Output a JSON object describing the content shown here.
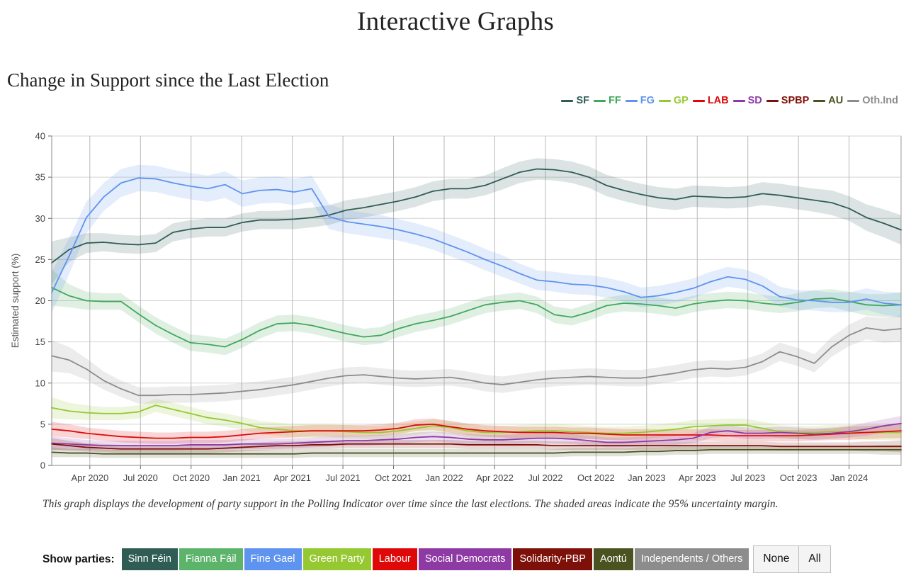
{
  "header": {
    "page_title": "Interactive Graphs",
    "section_title": "Change in Support since the Last Election"
  },
  "caption": "This graph displays the development of party support in the Polling Indicator over time since the last elections. The shaded areas indicate the 95% uncertainty margin.",
  "controls": {
    "show_parties_label": "Show parties:",
    "parties": [
      {
        "label": "Sinn Féin",
        "color": "#2f5d56"
      },
      {
        "label": "Fianna Fáil",
        "color": "#5cb36a"
      },
      {
        "label": "Fine Gael",
        "color": "#5e93ef"
      },
      {
        "label": "Green Party",
        "color": "#95c831"
      },
      {
        "label": "Labour",
        "color": "#df0808"
      },
      {
        "label": "Social Democrats",
        "color": "#8e3aa4"
      },
      {
        "label": "Solidarity-PBP",
        "color": "#7d1008"
      },
      {
        "label": "Aontú",
        "color": "#4a5320"
      },
      {
        "label": "Independents / Others",
        "color": "#8c8c8c"
      }
    ],
    "none_label": "None",
    "all_label": "All"
  },
  "chart_data": {
    "type": "line",
    "title": "Change in Support since the Last Election",
    "xlabel": "",
    "ylabel": "Estimated support (%)",
    "ylim": [
      0,
      40
    ],
    "yticks": [
      0,
      5,
      10,
      15,
      20,
      25,
      30,
      35,
      40
    ],
    "grid": true,
    "legend_position": "top-right",
    "uncertainty": "95% uncertainty margin (shaded bands)",
    "xticks": [
      "Apr 2020",
      "Jul 2020",
      "Oct 2020",
      "Jan 2021",
      "Apr 2021",
      "Jul 2021",
      "Oct 2021",
      "Jan 2022",
      "Apr 2022",
      "Jul 2022",
      "Oct 2022",
      "Jan 2023",
      "Apr 2023",
      "Jul 2023",
      "Oct 2023",
      "Jan 2024"
    ],
    "x_start": "Feb 2020",
    "x_end": "Mar 2024",
    "x": [
      0,
      1,
      2,
      3,
      4,
      5,
      6,
      7,
      8,
      9,
      10,
      11,
      12,
      13,
      14,
      15,
      16,
      17,
      18,
      19,
      20,
      21,
      22,
      23,
      24,
      25,
      26,
      27,
      28,
      29,
      30,
      31,
      32,
      33,
      34,
      35,
      36,
      37,
      38,
      39,
      40,
      41,
      42,
      43,
      44,
      45,
      46,
      47,
      48,
      49
    ],
    "series": [
      {
        "name": "SF",
        "legend": "SF",
        "full_name": "Sinn Féin",
        "color": "#2f5d56",
        "values": [
          24.6,
          26.2,
          27.0,
          27.1,
          26.9,
          26.8,
          27.0,
          28.3,
          28.7,
          28.9,
          28.9,
          29.5,
          29.8,
          29.8,
          29.9,
          30.1,
          30.4,
          31.0,
          31.3,
          31.7,
          32.1,
          32.6,
          33.3,
          33.6,
          33.6,
          34.0,
          34.8,
          35.6,
          36.0,
          35.9,
          35.6,
          35.0,
          34.0,
          33.4,
          32.9,
          32.5,
          32.3,
          32.7,
          32.6,
          32.5,
          32.6,
          33.0,
          32.8,
          32.5,
          32.2,
          31.9,
          31.2,
          30.1,
          29.4,
          28.6
        ],
        "ci": [
          2.6,
          1.5,
          1.2,
          1.1,
          1.1,
          1.1,
          1.1,
          1.1,
          1.1,
          1.1,
          1.1,
          1.1,
          1.1,
          1.1,
          1.2,
          1.2,
          1.2,
          1.2,
          1.2,
          1.2,
          1.2,
          1.2,
          1.2,
          1.2,
          1.2,
          1.2,
          1.3,
          1.3,
          1.3,
          1.3,
          1.3,
          1.3,
          1.3,
          1.3,
          1.3,
          1.3,
          1.3,
          1.3,
          1.3,
          1.3,
          1.3,
          1.4,
          1.4,
          1.4,
          1.4,
          1.5,
          1.5,
          1.6,
          1.7,
          1.8
        ]
      },
      {
        "name": "FF",
        "legend": "FF",
        "full_name": "Fianna Fáil",
        "color": "#3fa85a",
        "values": [
          21.6,
          20.6,
          20.0,
          19.9,
          19.9,
          18.4,
          17.0,
          15.9,
          14.9,
          14.7,
          14.4,
          15.3,
          16.4,
          17.2,
          17.3,
          17.0,
          16.5,
          16.0,
          15.6,
          15.8,
          16.6,
          17.2,
          17.6,
          18.1,
          18.8,
          19.5,
          19.8,
          20.0,
          19.5,
          18.3,
          18.0,
          18.6,
          19.4,
          19.7,
          19.6,
          19.4,
          19.1,
          19.6,
          19.9,
          20.1,
          20.0,
          19.7,
          19.5,
          19.8,
          20.2,
          20.3,
          19.9,
          19.5,
          19.4,
          19.5
        ],
        "ci": [
          2.2,
          1.4,
          1.1,
          1.0,
          1.0,
          1.0,
          1.0,
          1.0,
          1.0,
          1.0,
          1.0,
          1.0,
          1.0,
          1.0,
          1.0,
          1.0,
          1.0,
          1.0,
          1.0,
          1.0,
          1.0,
          1.0,
          1.0,
          1.0,
          1.0,
          1.0,
          1.0,
          1.0,
          1.0,
          1.0,
          1.0,
          1.0,
          1.0,
          1.0,
          1.0,
          1.0,
          1.0,
          1.0,
          1.0,
          1.0,
          1.0,
          1.0,
          1.0,
          1.1,
          1.1,
          1.1,
          1.2,
          1.3,
          1.4,
          1.5
        ]
      },
      {
        "name": "FG",
        "legend": "FG",
        "full_name": "Fine Gael",
        "color": "#5e93ef",
        "values": [
          21.0,
          25.4,
          30.1,
          32.6,
          34.3,
          34.9,
          34.8,
          34.3,
          33.9,
          33.6,
          34.1,
          33.0,
          33.4,
          33.5,
          33.2,
          33.6,
          30.2,
          29.6,
          29.3,
          29.0,
          28.6,
          28.1,
          27.5,
          26.7,
          25.9,
          25.0,
          24.2,
          23.3,
          22.5,
          22.3,
          22.0,
          21.9,
          21.6,
          21.1,
          20.4,
          20.6,
          21.0,
          21.5,
          22.3,
          22.9,
          22.6,
          21.8,
          20.5,
          20.1,
          20.0,
          19.8,
          19.8,
          20.2,
          19.7,
          19.5
        ],
        "ci": [
          2.5,
          2.2,
          1.9,
          1.7,
          1.7,
          1.6,
          1.6,
          1.6,
          1.6,
          1.6,
          1.6,
          1.6,
          1.6,
          1.6,
          1.6,
          1.6,
          1.5,
          1.4,
          1.4,
          1.4,
          1.3,
          1.3,
          1.3,
          1.3,
          1.3,
          1.3,
          1.3,
          1.2,
          1.2,
          1.2,
          1.2,
          1.2,
          1.2,
          1.2,
          1.2,
          1.2,
          1.2,
          1.2,
          1.2,
          1.2,
          1.2,
          1.2,
          1.2,
          1.2,
          1.2,
          1.2,
          1.2,
          1.3,
          1.4,
          1.5
        ]
      },
      {
        "name": "GP",
        "legend": "GP",
        "full_name": "Green Party",
        "color": "#95c831",
        "values": [
          7.0,
          6.6,
          6.4,
          6.3,
          6.3,
          6.5,
          7.3,
          6.8,
          6.3,
          5.8,
          5.5,
          5.1,
          4.6,
          4.4,
          4.2,
          4.2,
          4.2,
          4.1,
          4.0,
          4.0,
          4.2,
          4.5,
          4.8,
          4.6,
          4.2,
          4.0,
          4.0,
          4.1,
          4.2,
          4.2,
          4.1,
          4.0,
          3.9,
          3.9,
          4.0,
          4.2,
          4.4,
          4.7,
          4.8,
          4.9,
          4.9,
          4.5,
          4.1,
          4.0,
          4.0,
          4.1,
          4.1,
          4.0,
          4.0,
          4.0
        ],
        "ci": [
          1.3,
          1.0,
          0.9,
          0.8,
          0.8,
          0.8,
          0.8,
          0.8,
          0.8,
          0.8,
          0.8,
          0.8,
          0.8,
          0.8,
          0.8,
          0.8,
          0.8,
          0.8,
          0.8,
          0.8,
          0.8,
          0.8,
          0.8,
          0.8,
          0.8,
          0.8,
          0.8,
          0.8,
          0.8,
          0.8,
          0.8,
          0.8,
          0.8,
          0.8,
          0.8,
          0.8,
          0.8,
          0.8,
          0.8,
          0.8,
          0.8,
          0.8,
          0.8,
          0.8,
          0.8,
          0.8,
          0.8,
          0.9,
          0.9,
          1.0
        ]
      },
      {
        "name": "LAB",
        "legend": "LAB",
        "full_name": "Labour",
        "color": "#df0808",
        "values": [
          4.4,
          4.2,
          3.9,
          3.7,
          3.5,
          3.4,
          3.3,
          3.3,
          3.4,
          3.4,
          3.5,
          3.7,
          3.9,
          4.0,
          4.1,
          4.2,
          4.2,
          4.2,
          4.2,
          4.3,
          4.5,
          4.9,
          5.0,
          4.7,
          4.4,
          4.2,
          4.1,
          4.0,
          4.0,
          4.0,
          3.9,
          3.9,
          3.8,
          3.7,
          3.7,
          3.7,
          3.7,
          3.7,
          3.7,
          3.6,
          3.6,
          3.6,
          3.6,
          3.6,
          3.7,
          3.8,
          3.9,
          4.0,
          4.1,
          4.2
        ],
        "ci": [
          0.9,
          0.8,
          0.7,
          0.7,
          0.7,
          0.7,
          0.7,
          0.7,
          0.7,
          0.7,
          0.7,
          0.7,
          0.7,
          0.7,
          0.7,
          0.7,
          0.7,
          0.7,
          0.7,
          0.7,
          0.7,
          0.7,
          0.7,
          0.7,
          0.7,
          0.7,
          0.7,
          0.7,
          0.7,
          0.7,
          0.7,
          0.7,
          0.7,
          0.7,
          0.7,
          0.7,
          0.7,
          0.7,
          0.7,
          0.7,
          0.7,
          0.7,
          0.7,
          0.7,
          0.7,
          0.7,
          0.8,
          0.8,
          0.8,
          0.9
        ]
      },
      {
        "name": "SD",
        "legend": "SD",
        "full_name": "Social Democrats",
        "color": "#8e3aa4",
        "values": [
          2.7,
          2.6,
          2.5,
          2.4,
          2.4,
          2.4,
          2.4,
          2.4,
          2.5,
          2.5,
          2.5,
          2.6,
          2.6,
          2.6,
          2.7,
          2.8,
          2.9,
          3.0,
          3.0,
          3.1,
          3.2,
          3.4,
          3.5,
          3.4,
          3.2,
          3.1,
          3.1,
          3.2,
          3.3,
          3.3,
          3.2,
          3.0,
          2.8,
          2.8,
          2.9,
          3.0,
          3.1,
          3.3,
          4.0,
          4.2,
          3.9,
          3.9,
          4.0,
          3.9,
          3.8,
          3.9,
          4.1,
          4.4,
          4.8,
          5.1
        ],
        "ci": [
          0.8,
          0.7,
          0.6,
          0.6,
          0.6,
          0.6,
          0.6,
          0.6,
          0.6,
          0.6,
          0.6,
          0.6,
          0.6,
          0.6,
          0.6,
          0.6,
          0.6,
          0.6,
          0.6,
          0.6,
          0.6,
          0.6,
          0.6,
          0.6,
          0.6,
          0.6,
          0.6,
          0.6,
          0.6,
          0.6,
          0.6,
          0.6,
          0.6,
          0.6,
          0.6,
          0.6,
          0.6,
          0.6,
          0.7,
          0.7,
          0.7,
          0.7,
          0.7,
          0.7,
          0.7,
          0.7,
          0.7,
          0.8,
          0.8,
          0.9
        ]
      },
      {
        "name": "SPBP",
        "legend": "SPBP",
        "full_name": "Solidarity-PBP",
        "color": "#7d1008",
        "values": [
          2.6,
          2.4,
          2.2,
          2.1,
          2.0,
          2.0,
          2.0,
          2.0,
          2.0,
          2.0,
          2.1,
          2.2,
          2.3,
          2.4,
          2.4,
          2.5,
          2.5,
          2.6,
          2.6,
          2.6,
          2.6,
          2.6,
          2.6,
          2.6,
          2.5,
          2.5,
          2.5,
          2.5,
          2.5,
          2.4,
          2.4,
          2.4,
          2.4,
          2.4,
          2.4,
          2.4,
          2.4,
          2.4,
          2.4,
          2.4,
          2.4,
          2.4,
          2.3,
          2.3,
          2.3,
          2.3,
          2.3,
          2.3,
          2.3,
          2.3
        ],
        "ci": [
          0.7,
          0.6,
          0.5,
          0.5,
          0.5,
          0.5,
          0.5,
          0.5,
          0.5,
          0.5,
          0.5,
          0.5,
          0.5,
          0.5,
          0.5,
          0.5,
          0.5,
          0.5,
          0.5,
          0.5,
          0.5,
          0.5,
          0.5,
          0.5,
          0.5,
          0.5,
          0.5,
          0.5,
          0.5,
          0.5,
          0.5,
          0.5,
          0.5,
          0.5,
          0.5,
          0.5,
          0.5,
          0.5,
          0.5,
          0.5,
          0.5,
          0.5,
          0.5,
          0.5,
          0.5,
          0.5,
          0.5,
          0.6,
          0.6,
          0.7
        ]
      },
      {
        "name": "AU",
        "legend": "AU",
        "full_name": "Aontú",
        "color": "#4a5320",
        "values": [
          1.6,
          1.5,
          1.5,
          1.4,
          1.4,
          1.4,
          1.4,
          1.4,
          1.4,
          1.4,
          1.4,
          1.4,
          1.4,
          1.4,
          1.4,
          1.5,
          1.5,
          1.5,
          1.5,
          1.5,
          1.5,
          1.5,
          1.5,
          1.5,
          1.5,
          1.5,
          1.5,
          1.5,
          1.5,
          1.5,
          1.6,
          1.6,
          1.6,
          1.6,
          1.7,
          1.7,
          1.8,
          1.8,
          1.9,
          1.9,
          1.9,
          1.9,
          1.9,
          1.9,
          1.9,
          1.9,
          1.9,
          1.9,
          1.9,
          1.9
        ],
        "ci": [
          0.6,
          0.5,
          0.5,
          0.5,
          0.5,
          0.5,
          0.5,
          0.5,
          0.5,
          0.5,
          0.5,
          0.5,
          0.5,
          0.5,
          0.5,
          0.5,
          0.5,
          0.5,
          0.5,
          0.5,
          0.5,
          0.5,
          0.5,
          0.5,
          0.5,
          0.5,
          0.5,
          0.5,
          0.5,
          0.5,
          0.5,
          0.5,
          0.5,
          0.5,
          0.5,
          0.5,
          0.5,
          0.5,
          0.5,
          0.5,
          0.5,
          0.5,
          0.5,
          0.5,
          0.5,
          0.5,
          0.5,
          0.5,
          0.6,
          0.6
        ]
      },
      {
        "name": "Oth.Ind",
        "legend": "Oth.Ind",
        "full_name": "Independents / Others",
        "color": "#8c8c8c",
        "values": [
          13.3,
          12.8,
          11.7,
          10.3,
          9.3,
          8.5,
          8.5,
          8.6,
          8.6,
          8.7,
          8.8,
          9.0,
          9.2,
          9.5,
          9.8,
          10.2,
          10.6,
          10.9,
          11.0,
          10.8,
          10.6,
          10.5,
          10.6,
          10.7,
          10.4,
          10.0,
          9.8,
          10.1,
          10.4,
          10.6,
          10.7,
          10.8,
          10.7,
          10.6,
          10.6,
          10.9,
          11.2,
          11.6,
          11.8,
          11.7,
          11.9,
          12.6,
          13.8,
          13.2,
          12.4,
          14.4,
          15.8,
          16.7,
          16.4,
          16.6
        ],
        "ci": [
          1.9,
          1.6,
          1.3,
          1.1,
          1.0,
          1.0,
          1.0,
          1.0,
          1.0,
          1.0,
          1.0,
          1.0,
          1.0,
          1.0,
          1.0,
          1.0,
          1.0,
          1.0,
          1.0,
          1.0,
          1.0,
          1.0,
          1.0,
          1.0,
          1.0,
          1.0,
          1.0,
          1.0,
          1.0,
          1.0,
          1.0,
          1.0,
          1.0,
          1.0,
          1.0,
          1.0,
          1.0,
          1.0,
          1.0,
          1.0,
          1.0,
          1.0,
          1.1,
          1.1,
          1.1,
          1.2,
          1.3,
          1.4,
          1.5,
          1.6
        ]
      }
    ]
  }
}
